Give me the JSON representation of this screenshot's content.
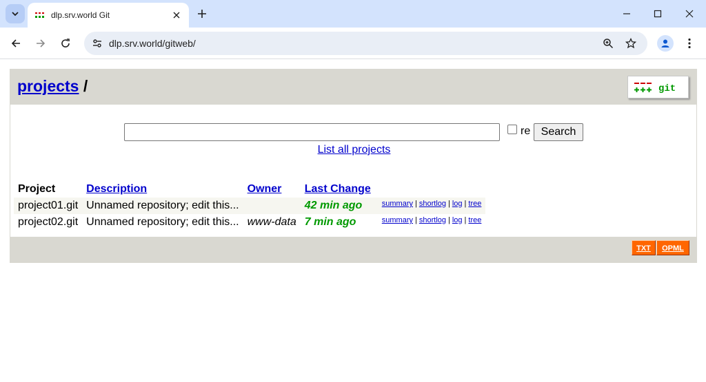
{
  "browser": {
    "tab_title": "dlp.srv.world Git",
    "url": "dlp.srv.world/gitweb/"
  },
  "header": {
    "projects_link": "projects",
    "separator": "/",
    "logo_text": "git"
  },
  "search": {
    "value": "",
    "regex_label": "re",
    "button_label": "Search"
  },
  "list_all_link": "List all projects",
  "table": {
    "columns": [
      "Project",
      "Description",
      "Owner",
      "Last Change"
    ],
    "rows": [
      {
        "project": "project01.git",
        "description": "Unnamed repository; edit this...",
        "owner": "",
        "last_change": "42 min ago",
        "links": [
          "summary",
          "shortlog",
          "log",
          "tree"
        ]
      },
      {
        "project": "project02.git",
        "description": "Unnamed repository; edit this...",
        "owner": "www-data",
        "last_change": "7 min ago",
        "links": [
          "summary",
          "shortlog",
          "log",
          "tree"
        ]
      }
    ]
  },
  "footer": {
    "feeds": [
      "TXT",
      "OPML"
    ]
  },
  "colors": {
    "link": "#0000cc",
    "header_bg": "#d9d8d1",
    "age_recent": "#009900",
    "feed_bg": "#ff6600",
    "tabstrip_bg": "#d3e3fd"
  }
}
